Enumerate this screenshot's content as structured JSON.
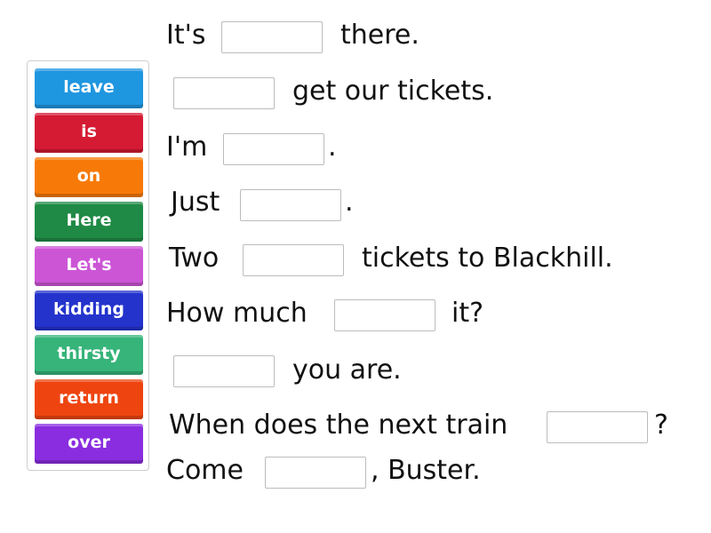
{
  "word_bank": {
    "tiles": [
      {
        "label": "leave",
        "color": "#1f96e0"
      },
      {
        "label": "is",
        "color": "#d51a34"
      },
      {
        "label": "on",
        "color": "#f77a08"
      },
      {
        "label": "Here",
        "color": "#1f8a45"
      },
      {
        "label": "Let's",
        "color": "#cc55d6"
      },
      {
        "label": "kidding",
        "color": "#2433cc"
      },
      {
        "label": "thirsty",
        "color": "#36b47a"
      },
      {
        "label": "return",
        "color": "#ee4510"
      },
      {
        "label": "over",
        "color": "#8a2de0"
      }
    ]
  },
  "sentences": [
    {
      "before": "It's",
      "after": "there."
    },
    {
      "before": "",
      "after": "get our tickets."
    },
    {
      "before": "I'm",
      "after": "."
    },
    {
      "before": "Just",
      "after": "."
    },
    {
      "before": "Two",
      "after": "tickets to Blackhill."
    },
    {
      "before": "How much",
      "after": "it?"
    },
    {
      "before": "",
      "after": "you are."
    },
    {
      "before": "When does the next train",
      "after": "?"
    },
    {
      "before": "Come",
      "after": ", Buster."
    }
  ],
  "blanks": [
    "",
    "",
    "",
    "",
    "",
    "",
    "",
    "",
    ""
  ]
}
